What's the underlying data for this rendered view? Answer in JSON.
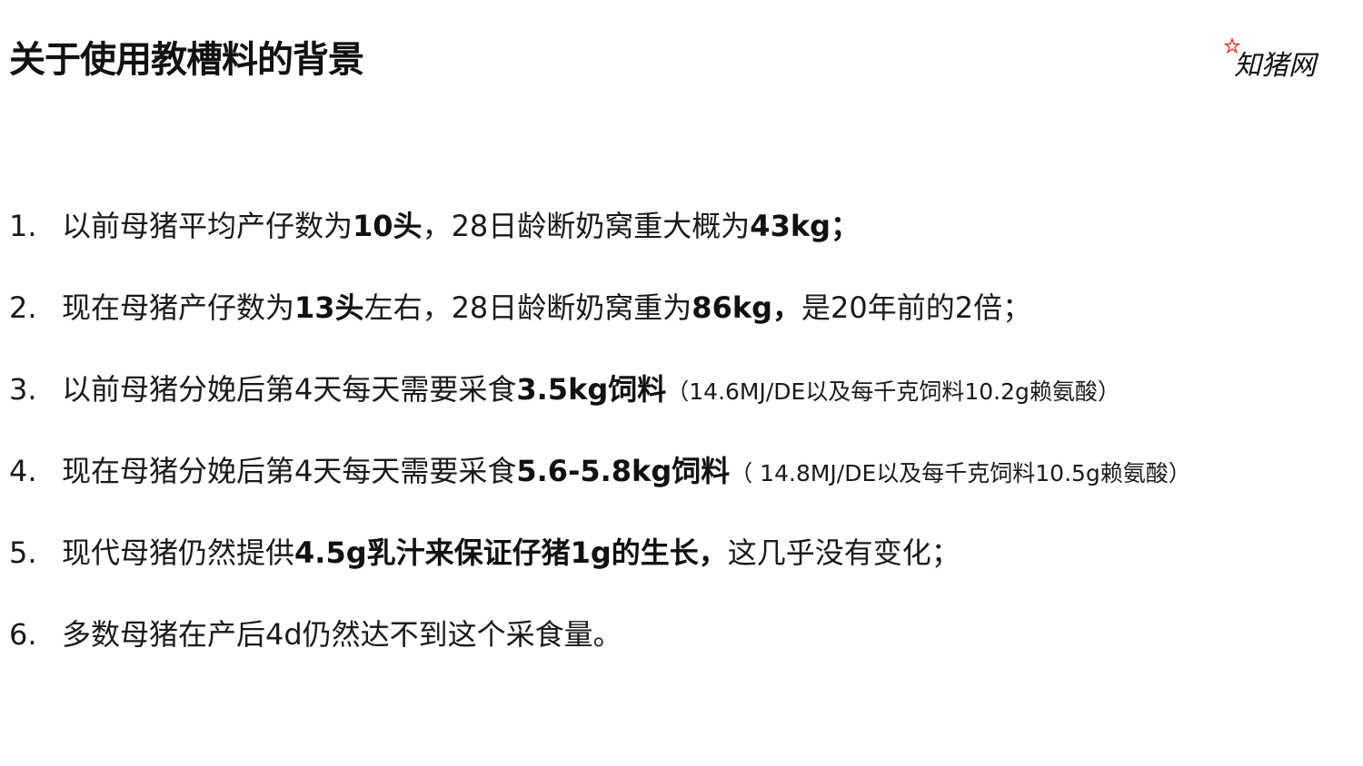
{
  "title": "关于使用教槽料的背景",
  "logo": {
    "text": "知猪网",
    "icon": "red-star-icon",
    "accent_color": "#d93a3a"
  },
  "items": [
    {
      "num": "1.",
      "parts": [
        {
          "t": "以前母猪平均产仔数为"
        },
        {
          "t": "10头",
          "b": true
        },
        {
          "t": "，28日龄断奶窝重大概为"
        },
        {
          "t": "43kg；",
          "b": true
        }
      ]
    },
    {
      "num": "2.",
      "parts": [
        {
          "t": "现在母猪产仔数为"
        },
        {
          "t": "13头",
          "b": true
        },
        {
          "t": "左右，28日龄断奶窝重为"
        },
        {
          "t": "86kg，",
          "b": true
        },
        {
          "t": "是20年前的2倍；"
        }
      ]
    },
    {
      "num": "3.",
      "parts": [
        {
          "t": "以前母猪分娩后第4天每天需要采食"
        },
        {
          "t": "3.5kg饲料",
          "b": true
        },
        {
          "t": "（14.6MJ/DE以及每千克饲料10.2g赖氨酸）",
          "s": true
        }
      ]
    },
    {
      "num": "4.",
      "parts": [
        {
          "t": "现在母猪分娩后第4天每天需要采食"
        },
        {
          "t": "5.6-5.8kg饲料",
          "b": true
        },
        {
          "t": "（ 14.8MJ/DE以及每千克饲料10.5g赖氨酸）",
          "s": true
        }
      ]
    },
    {
      "num": "5.",
      "parts": [
        {
          "t": "现代母猪仍然提供"
        },
        {
          "t": "4.5g乳汁来保证仔猪1g的生长，",
          "b": true
        },
        {
          "t": "这几乎没有变化；"
        }
      ]
    },
    {
      "num": "6.",
      "parts": [
        {
          "t": "多数母猪在产后4d仍然达不到这个采食量。"
        }
      ]
    }
  ]
}
